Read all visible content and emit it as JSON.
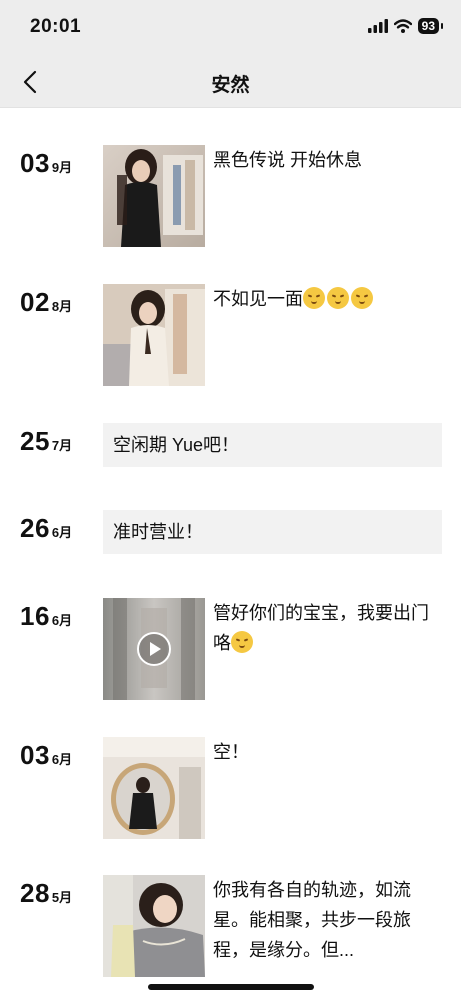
{
  "status_bar": {
    "time": "20:01",
    "battery": "93",
    "icons": [
      "signal-icon",
      "wifi-icon",
      "battery-icon"
    ]
  },
  "header": {
    "title": "安然",
    "back_icon": "chevron-left-icon"
  },
  "posts": [
    {
      "day": "03",
      "month": "9月",
      "type": "photo",
      "text": "黑色传说 开始休息",
      "emoji_count": 0
    },
    {
      "day": "02",
      "month": "8月",
      "type": "photo",
      "text": "不如见一面",
      "emoji_count": 3
    },
    {
      "day": "25",
      "month": "7月",
      "type": "text",
      "text": "空闲期 Yue吧！"
    },
    {
      "day": "26",
      "month": "6月",
      "type": "text",
      "text": "准时营业！"
    },
    {
      "day": "16",
      "month": "6月",
      "type": "video",
      "text": "管好你们的宝宝，我要出门咯",
      "emoji_count": 1
    },
    {
      "day": "03",
      "month": "6月",
      "type": "photo",
      "text": "空！",
      "emoji_count": 0
    },
    {
      "day": "28",
      "month": "5月",
      "type": "photo",
      "text": "你我有各自的轨迹，如流星。能相聚，共步一段旅程，是缘分。但...",
      "emoji_count": 0
    }
  ],
  "colors": {
    "bar_bg": "#ededed",
    "text_box_bg": "#f2f2f2",
    "text": "#111111"
  }
}
